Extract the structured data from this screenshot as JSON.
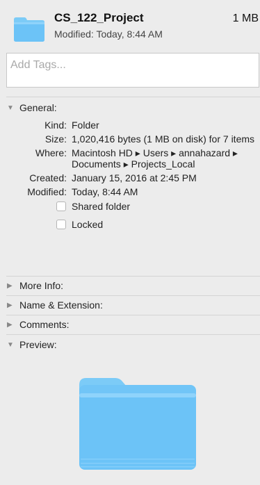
{
  "header": {
    "file_name": "CS_122_Project",
    "file_size": "1 MB",
    "modified": "Modified: Today, 8:44 AM",
    "icon": "folder-icon"
  },
  "tags": {
    "placeholder": "Add Tags..."
  },
  "sections": {
    "general": {
      "label": "General:",
      "expanded": true
    },
    "more_info": {
      "label": "More Info:",
      "expanded": false
    },
    "name_ext": {
      "label": "Name & Extension:",
      "expanded": false
    },
    "comments": {
      "label": "Comments:",
      "expanded": false
    },
    "preview": {
      "label": "Preview:",
      "expanded": true
    }
  },
  "general": {
    "kind_label": "Kind:",
    "kind_value": "Folder",
    "size_label": "Size:",
    "size_value": "1,020,416 bytes (1 MB on disk) for 7 items",
    "where_label": "Where:",
    "where_value": "Macintosh HD ▸ Users ▸ annahazard ▸ Documents ▸ Projects_Local",
    "created_label": "Created:",
    "created_value": "January 15, 2016 at 2:45 PM",
    "modified_label": "Modified:",
    "modified_value": "Today, 8:44 AM",
    "shared_folder_label": "Shared folder",
    "locked_label": "Locked",
    "shared_folder_checked": false,
    "locked_checked": false
  },
  "colors": {
    "folder_light": "#8fd3fb",
    "folder_main": "#6cc3f7",
    "folder_tab": "#7ccbf7"
  }
}
